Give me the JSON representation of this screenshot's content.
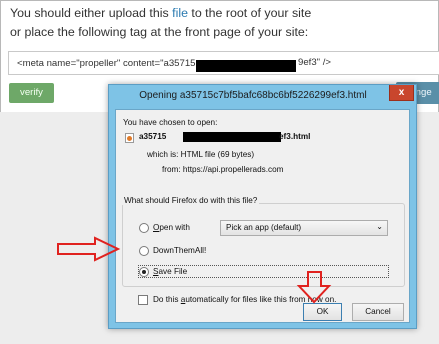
{
  "page": {
    "instruction_pre": "You should either upload this ",
    "instruction_link": "file",
    "instruction_mid": " to the root of your site",
    "instruction_line2": "or place the following tag at the front page of your site:",
    "meta_tag_start": "<meta name=\"propeller\" content=\"a35715",
    "meta_tag_end": "9ef3\" />",
    "verify_label": "verify",
    "change_label": "hange"
  },
  "dialog": {
    "title": "Opening a35715c7bf5bafc68bc6bf5226299ef3.html",
    "close_label": "x",
    "chosen_label": "You have chosen to open:",
    "filename_start": "a35715",
    "filename_end": "ef3.html",
    "which_is": "which is:  HTML file (69 bytes)",
    "from": "from:  https://api.propellerads.com",
    "question": "What should Firefox do with this file?",
    "open_with_access": "O",
    "open_with_rest": "pen with",
    "app_select": "Pick an app (default)",
    "downthemall": "DownThemAll!",
    "save_access": "S",
    "save_rest": "ave File",
    "auto_pre": "Do this ",
    "auto_access": "a",
    "auto_rest": "utomatically for files like this from now on.",
    "ok_label": "OK",
    "cancel_label": "Cancel",
    "selected_option": "Save File",
    "auto_checked": false
  },
  "colors": {
    "annotation_arrow": "#e0221f",
    "dialog_frame": "#7ec3e6",
    "close_button": "#c9462d",
    "link": "#2a7ab0",
    "verify_button": "#6ea868"
  }
}
